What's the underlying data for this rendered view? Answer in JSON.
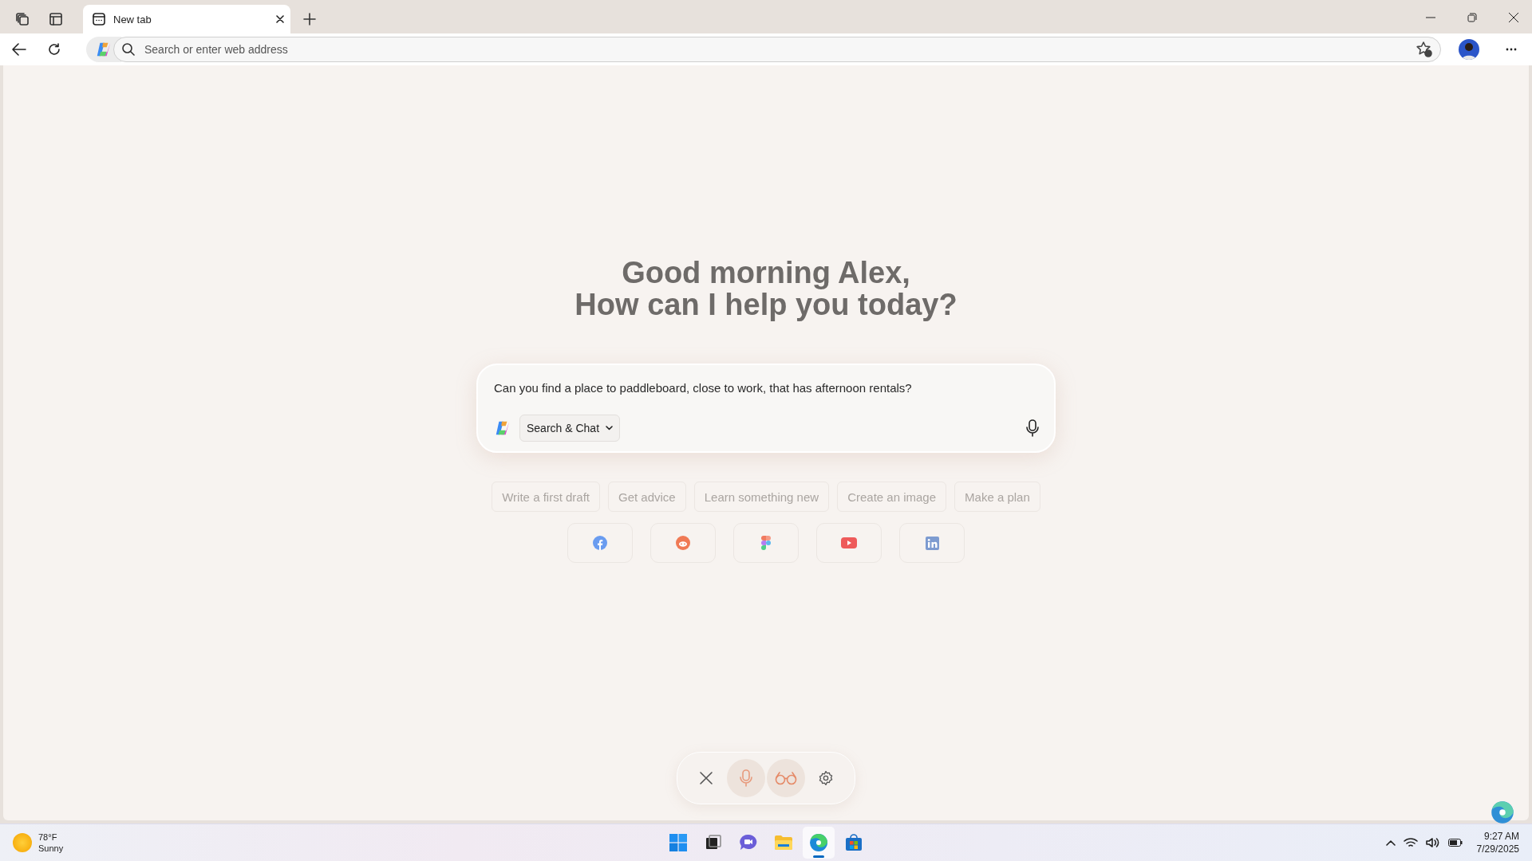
{
  "browser": {
    "tabs": [
      {
        "title": "New tab",
        "selected": true
      }
    ],
    "address": {
      "placeholder": "Search or enter web address"
    }
  },
  "greeting": {
    "line_1": "Good morning Alex,",
    "line_2": "How can I help you today?"
  },
  "composer": {
    "value": "Can you find a place to paddleboard, close to work, that has afternoon rentals?",
    "mode": "Search & Chat"
  },
  "suggestions": [
    "Write a first draft",
    "Get advice",
    "Learn something new",
    "Create an image",
    "Make a plan"
  ],
  "shortcuts": [
    {
      "kind": "facebook"
    },
    {
      "kind": "reddit"
    },
    {
      "kind": "figma"
    },
    {
      "kind": "youtube"
    },
    {
      "kind": "linkedin"
    }
  ],
  "voice_bar": [
    {
      "kind": "close",
      "selected": false
    },
    {
      "kind": "mic",
      "selected": true
    },
    {
      "kind": "vision",
      "selected": true
    },
    {
      "kind": "settings",
      "selected": false
    }
  ],
  "taskbar": {
    "weather": {
      "temp": "78°F",
      "condition": "Sunny"
    },
    "apps": [
      {
        "kind": "start",
        "selected": false
      },
      {
        "kind": "taskview",
        "selected": false
      },
      {
        "kind": "chat",
        "selected": false
      },
      {
        "kind": "files",
        "selected": false
      },
      {
        "kind": "browser",
        "selected": true
      },
      {
        "kind": "store",
        "selected": false
      }
    ],
    "time": "9:27 AM",
    "date": "7/29/2025"
  }
}
